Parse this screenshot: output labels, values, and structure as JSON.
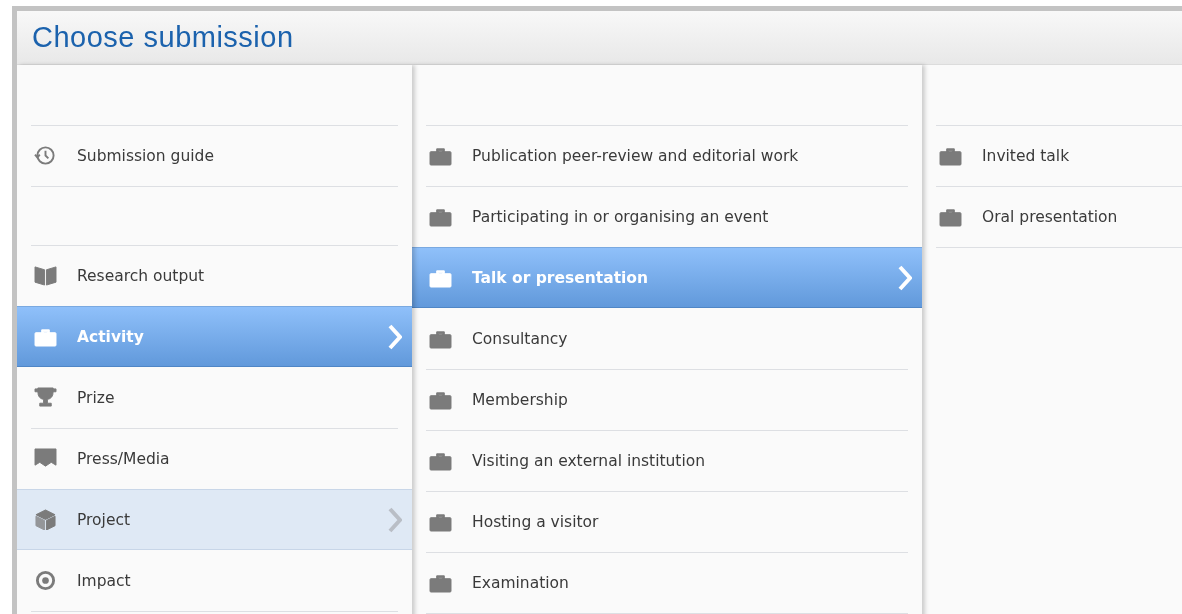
{
  "dialog": {
    "title": "Choose submission"
  },
  "columns": [
    {
      "groups": [
        [
          {
            "label": "Submission guide",
            "kind": "guide",
            "selected": false,
            "hovered": false
          }
        ],
        [
          {
            "label": "Research output",
            "kind": "book",
            "selected": false,
            "hovered": false
          },
          {
            "label": "Activity",
            "kind": "briefcase",
            "selected": true,
            "hovered": false
          },
          {
            "label": "Prize",
            "kind": "trophy",
            "selected": false,
            "hovered": false
          },
          {
            "label": "Press/Media",
            "kind": "press",
            "selected": false,
            "hovered": false
          },
          {
            "label": "Project",
            "kind": "cube",
            "selected": false,
            "hovered": true
          },
          {
            "label": "Impact",
            "kind": "target",
            "selected": false,
            "hovered": false
          }
        ]
      ]
    },
    {
      "groups": [
        [
          {
            "label": "Publication peer-review and editorial work",
            "kind": "briefcase",
            "selected": false,
            "hovered": false
          },
          {
            "label": "Participating in or organising an event",
            "kind": "briefcase",
            "selected": false,
            "hovered": false
          },
          {
            "label": "Talk or presentation",
            "kind": "briefcase",
            "selected": true,
            "hovered": false
          },
          {
            "label": "Consultancy",
            "kind": "briefcase",
            "selected": false,
            "hovered": false
          },
          {
            "label": "Membership",
            "kind": "briefcase",
            "selected": false,
            "hovered": false
          },
          {
            "label": "Visiting an external institution",
            "kind": "briefcase",
            "selected": false,
            "hovered": false
          },
          {
            "label": "Hosting a visitor",
            "kind": "briefcase",
            "selected": false,
            "hovered": false
          },
          {
            "label": "Examination",
            "kind": "briefcase",
            "selected": false,
            "hovered": false
          }
        ]
      ]
    },
    {
      "groups": [
        [
          {
            "label": "Invited talk",
            "kind": "briefcase",
            "selected": false,
            "hovered": false
          },
          {
            "label": "Oral presentation",
            "kind": "briefcase",
            "selected": false,
            "hovered": false
          }
        ]
      ]
    }
  ]
}
